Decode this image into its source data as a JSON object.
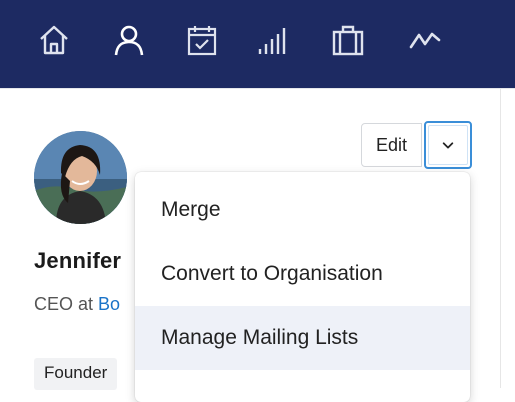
{
  "nav": {
    "items": [
      {
        "icon": "home-icon",
        "label": "Home"
      },
      {
        "icon": "person-icon",
        "label": "People"
      },
      {
        "icon": "calendar-check-icon",
        "label": "Calendar"
      },
      {
        "icon": "bar-chart-icon",
        "label": "Reports"
      },
      {
        "icon": "briefcase-icon",
        "label": "Cases"
      },
      {
        "icon": "activity-line-icon",
        "label": "Activity"
      }
    ],
    "colors": {
      "background": "#1d2a62",
      "icon": "#dfe3ee"
    }
  },
  "contact": {
    "name": "Jennifer",
    "role_prefix": "CEO at ",
    "organisation": "Bo",
    "tag": "Founder"
  },
  "actions": {
    "edit_label": "Edit",
    "dropdown_icon": "chevron-down-icon",
    "accent_color": "#3a8ed8"
  },
  "menu": {
    "items": [
      {
        "label": "Merge"
      },
      {
        "label": "Convert to Organisation"
      },
      {
        "label": "Manage Mailing Lists",
        "highlighted": true
      }
    ]
  }
}
